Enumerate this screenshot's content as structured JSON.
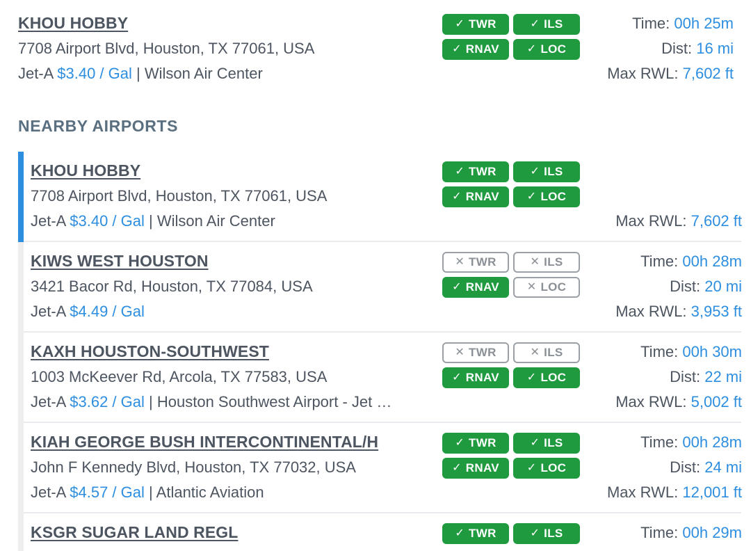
{
  "selected": {
    "name": "KHOU HOBBY",
    "address": "7708 Airport Blvd, Houston, TX 77061, USA",
    "fuel_type": "Jet-A",
    "fuel_price": "$3.40 / Gal",
    "separator": "|",
    "fbo": "Wilson Air Center",
    "badges": [
      {
        "label": "TWR",
        "available": true
      },
      {
        "label": "ILS",
        "available": true
      },
      {
        "label": "RNAV",
        "available": true
      },
      {
        "label": "LOC",
        "available": true
      }
    ],
    "time_label": "Time:",
    "time_value": "00h 25m",
    "dist_label": "Dist:",
    "dist_value": "16 mi",
    "rwl_label": "Max RWL:",
    "rwl_value": "7,602 ft"
  },
  "section_title": "NEARBY AIRPORTS",
  "icons": {
    "check": "✓",
    "cross": "✕"
  },
  "nearby": [
    {
      "name": "KHOU HOBBY",
      "address": "7708 Airport Blvd, Houston, TX 77061, USA",
      "fuel_type": "Jet-A",
      "fuel_price": "$3.40 / Gal",
      "separator": "|",
      "fbo": "Wilson Air Center",
      "badges": {
        "twr": true,
        "ils": true,
        "rnav": true,
        "loc": true
      },
      "rwl_label": "Max RWL:",
      "rwl_value": "7,602 ft"
    },
    {
      "name": "KIWS WEST HOUSTON",
      "address": "3421 Bacor Rd, Houston, TX 77084, USA",
      "fuel_type": "Jet-A",
      "fuel_price": "$4.49 / Gal",
      "badges": {
        "twr": false,
        "ils": false,
        "rnav": true,
        "loc": false
      },
      "time_label": "Time:",
      "time_value": "00h 28m",
      "dist_label": "Dist:",
      "dist_value": "20 mi",
      "rwl_label": "Max RWL:",
      "rwl_value": "3,953 ft"
    },
    {
      "name": "KAXH HOUSTON-SOUTHWEST",
      "address": "1003 McKeever Rd, Arcola, TX 77583, USA",
      "fuel_type": "Jet-A",
      "fuel_price": "$3.62 / Gal",
      "separator": "|",
      "fbo": "Houston Southwest Airport - Jet …",
      "badges": {
        "twr": false,
        "ils": false,
        "rnav": true,
        "loc": true
      },
      "time_label": "Time:",
      "time_value": "00h 30m",
      "dist_label": "Dist:",
      "dist_value": "22 mi",
      "rwl_label": "Max RWL:",
      "rwl_value": "5,002 ft"
    },
    {
      "name": "KIAH GEORGE BUSH INTERCONTINENTAL/H",
      "address": "John F Kennedy Blvd, Houston, TX 77032, USA",
      "fuel_type": "Jet-A",
      "fuel_price": "$4.57 / Gal",
      "separator": "|",
      "fbo": "Atlantic Aviation",
      "badges": {
        "twr": true,
        "ils": true,
        "rnav": true,
        "loc": true
      },
      "time_label": "Time:",
      "time_value": "00h 28m",
      "dist_label": "Dist:",
      "dist_value": "24 mi",
      "rwl_label": "Max RWL:",
      "rwl_value": "12,001 ft"
    },
    {
      "name": "KSGR SUGAR LAND REGL",
      "badges": {
        "twr": true,
        "ils": true,
        "rnav": true,
        "loc": true
      },
      "time_label": "Time:",
      "time_value": "00h 29m"
    }
  ],
  "badge_labels": {
    "twr": "TWR",
    "ils": "ILS",
    "rnav": "RNAV",
    "loc": "LOC"
  },
  "colors": {
    "accent": "#2d8ee0",
    "available": "#1f9a3f",
    "unavailable_border": "#9aa0a6",
    "text": "#4d5560"
  }
}
